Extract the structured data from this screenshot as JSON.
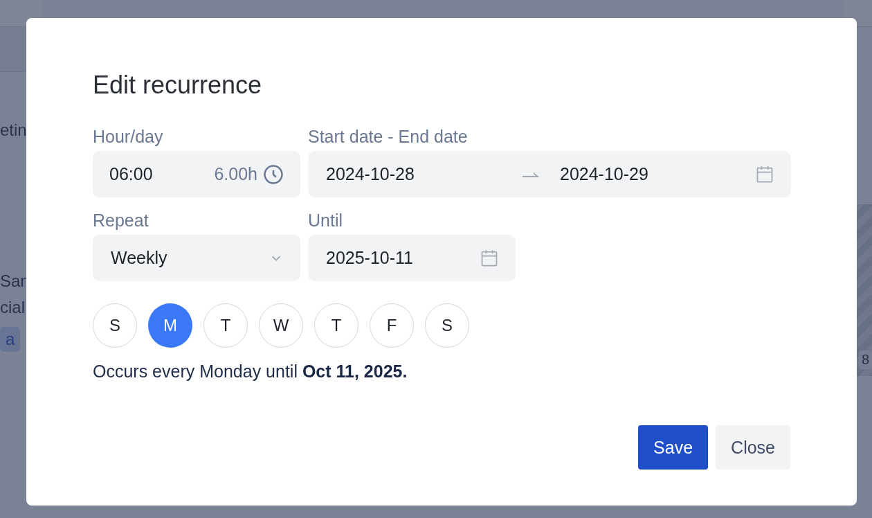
{
  "background": {
    "left_texts": [
      {
        "text": "etin",
        "kind": "plain"
      },
      {
        "text": "San",
        "kind": "name"
      },
      {
        "text": "cial",
        "kind": "plain"
      },
      {
        "text": "a",
        "kind": "tag"
      }
    ],
    "right_texts": [
      {
        "text": "8",
        "kind": "tag"
      }
    ]
  },
  "dialog": {
    "title": "Edit recurrence",
    "hour_day": {
      "label": "Hour/day",
      "value": "06:00",
      "duration": "6.00h"
    },
    "date_range": {
      "label": "Start date - End date",
      "start": "2024-10-28",
      "end": "2024-10-29"
    },
    "repeat": {
      "label": "Repeat",
      "value": "Weekly"
    },
    "until": {
      "label": "Until",
      "value": "2025-10-11"
    },
    "days": [
      {
        "label": "S",
        "selected": false
      },
      {
        "label": "M",
        "selected": true
      },
      {
        "label": "T",
        "selected": false
      },
      {
        "label": "W",
        "selected": false
      },
      {
        "label": "T",
        "selected": false
      },
      {
        "label": "F",
        "selected": false
      },
      {
        "label": "S",
        "selected": false
      }
    ],
    "summary": "Occurs every Monday until **Oct 11, 2025.**",
    "buttons": [
      {
        "label": "Save",
        "kind": "primary"
      },
      {
        "label": "Close",
        "kind": "secondary"
      }
    ]
  }
}
